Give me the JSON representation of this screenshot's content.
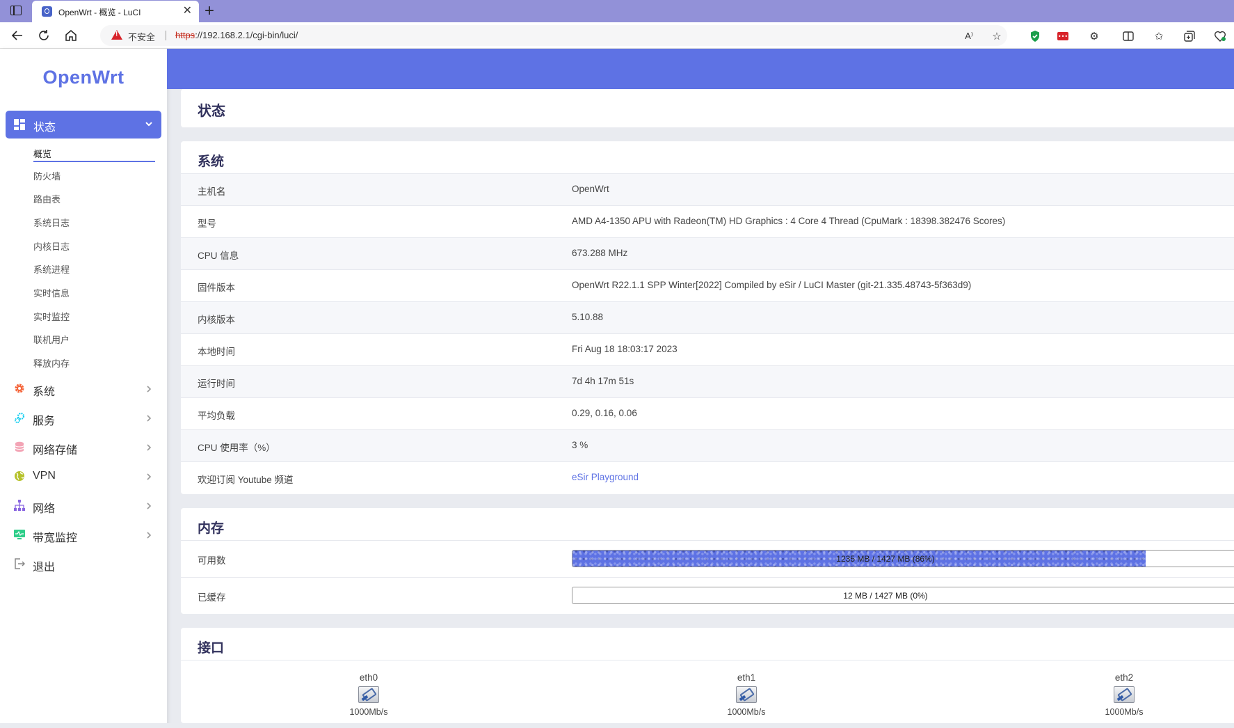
{
  "browser": {
    "tab_title": "OpenWrt - 概览 - LuCI",
    "insecure_label": "不安全",
    "url_proto": "https",
    "url_rest": "://192.168.2.1/cgi-bin/luci/"
  },
  "sidebar": {
    "logo": "OpenWrt",
    "active_menu": "状态",
    "sub_items": [
      "概览",
      "防火墙",
      "路由表",
      "系统日志",
      "内核日志",
      "系统进程",
      "实时信息",
      "实时监控",
      "联机用户",
      "释放内存"
    ],
    "menu_items": [
      {
        "label": "系统",
        "icon": "gear-icon"
      },
      {
        "label": "服务",
        "icon": "services-icon"
      },
      {
        "label": "网络存储",
        "icon": "storage-icon"
      },
      {
        "label": "VPN",
        "icon": "globe-icon"
      },
      {
        "label": "网络",
        "icon": "network-icon"
      },
      {
        "label": "带宽监控",
        "icon": "monitor-icon"
      },
      {
        "label": "退出",
        "icon": "logout-icon"
      }
    ]
  },
  "main": {
    "page_title": "状态",
    "system": {
      "title": "系统",
      "rows": [
        {
          "key": "主机名",
          "value": "OpenWrt"
        },
        {
          "key": "型号",
          "value": "AMD A4-1350 APU with Radeon(TM) HD Graphics : 4 Core 4 Thread (CpuMark : 18398.382476 Scores)"
        },
        {
          "key": "CPU 信息",
          "value": "673.288 MHz"
        },
        {
          "key": "固件版本",
          "value": "OpenWrt R22.1.1 SPP Winter[2022] Compiled by eSir / LuCI Master (git-21.335.48743-5f363d9)"
        },
        {
          "key": "内核版本",
          "value": "5.10.88"
        },
        {
          "key": "本地时间",
          "value": "Fri Aug 18 18:03:17 2023"
        },
        {
          "key": "运行时间",
          "value": "7d 4h 17m 51s"
        },
        {
          "key": "平均负载",
          "value": "0.29, 0.16, 0.06"
        },
        {
          "key": "CPU 使用率（%）",
          "value": "3 %"
        },
        {
          "key": "欢迎订阅 Youtube 频道",
          "value": "eSir Playground"
        }
      ]
    },
    "memory": {
      "title": "内存",
      "rows": [
        {
          "key": "可用数",
          "text": "1235 MB / 1427 MB (86%)",
          "fraction": 0.86
        },
        {
          "key": "已缓存",
          "text": "12 MB / 1427 MB (0%)",
          "fraction": 0.0
        }
      ]
    },
    "interfaces": {
      "title": "接口",
      "items": [
        {
          "name": "eth0",
          "speed": "1000Mb/s"
        },
        {
          "name": "eth1",
          "speed": "1000Mb/s"
        },
        {
          "name": "eth2",
          "speed": "1000Mb/s"
        }
      ]
    }
  }
}
